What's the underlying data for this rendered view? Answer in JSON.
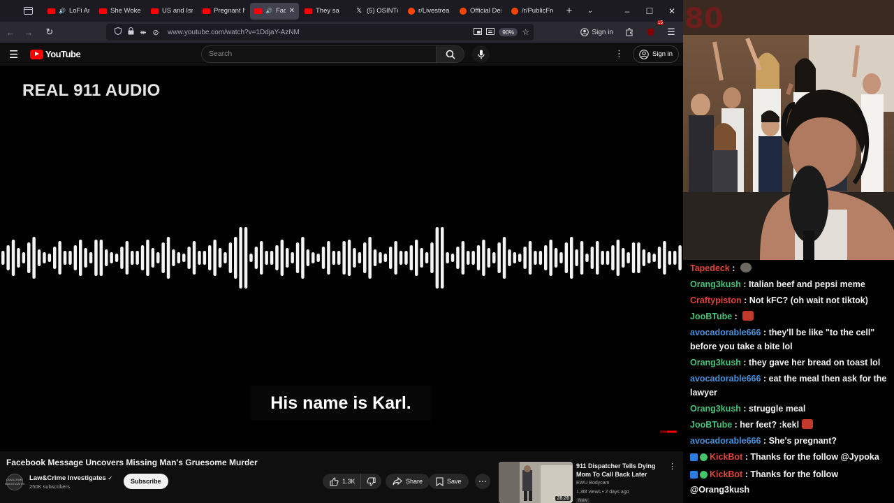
{
  "browser": {
    "tabs": [
      {
        "label": "LoFi Ar",
        "fav": "youtube",
        "audio": true
      },
      {
        "label": "She Woke U",
        "fav": "youtube"
      },
      {
        "label": "US and Isra",
        "fav": "youtube"
      },
      {
        "label": "Pregnant M",
        "fav": "youtube"
      },
      {
        "label": "Face",
        "fav": "youtube",
        "audio": true,
        "active": true
      },
      {
        "label": "They sa",
        "fav": "youtube"
      },
      {
        "label": "(5) OSINTdc",
        "fav": "x"
      },
      {
        "label": "r/Livestrean",
        "fav": "reddit"
      },
      {
        "label": "Official Des",
        "fav": "reddit"
      },
      {
        "label": "/r/PublicFre",
        "fav": "reddit"
      }
    ],
    "url": "www.youtube.com/watch?v=1DdjaY-AzNM",
    "zoom": "90%",
    "signin_label": "Sign in",
    "ext_badge": "15"
  },
  "youtube": {
    "logo_text": "YouTube",
    "search_placeholder": "Search",
    "signin_label": "Sign in"
  },
  "video": {
    "overlay_title": "REAL 911 AUDIO",
    "caption": "His name is Karl.",
    "title": "Facebook Message Uncovers Missing Man's Gruesome Murder",
    "channel": "Law&Crime Investigates",
    "channel_avatar_text": "LAW&CRIME INVESTIGATES",
    "subscribers": "250K subscribers",
    "subscribe_label": "Subscribe",
    "likes": "1.3K",
    "share_label": "Share",
    "save_label": "Save"
  },
  "recommended": {
    "title": "911 Dispatcher Tells Dying Mom To Call Back Later",
    "channel": "EWU Bodycam",
    "meta": "1.3M views • 2 days ago",
    "badge": "New",
    "duration": "28:26"
  },
  "colors": {
    "yt_red": "#ff0000",
    "chat_blue": "#4a90d9",
    "chat_green": "#47c27a",
    "chat_red": "#e0433a"
  },
  "chat": [
    {
      "user": "Tapedeck",
      "color": "#e0433a",
      "text": "",
      "emote": "pepe"
    },
    {
      "user": "Orang3kush",
      "color": "#47c27a",
      "text": "Italian beef and pepsi meme"
    },
    {
      "user": "Craftypiston",
      "color": "#e0433a",
      "text": "Not kFC? (oh wait not tiktok)"
    },
    {
      "user": "JooBTube",
      "color": "#47c27a",
      "text": "",
      "emote": "devil"
    },
    {
      "user": "avocadorable666",
      "color": "#4a90d9",
      "text": "they'll be like \"to the cell\" before you take a bite lol"
    },
    {
      "user": "Orang3kush",
      "color": "#47c27a",
      "text": "they gave her bread on toast lol"
    },
    {
      "user": "avocadorable666",
      "color": "#4a90d9",
      "text": "eat the meal then ask for the lawyer"
    },
    {
      "user": "Orang3kush",
      "color": "#47c27a",
      "text": "struggle meal"
    },
    {
      "user": "JooBTube",
      "color": "#47c27a",
      "text": "her feet? :kekl",
      "emote": "devil"
    },
    {
      "user": "avocadorable666",
      "color": "#4a90d9",
      "text": "She's pregnant?"
    },
    {
      "user": "KickBot",
      "color": "#e0433a",
      "text": "Thanks for the follow @Jypoka",
      "bot": true
    },
    {
      "user": "KickBot",
      "color": "#e0433a",
      "text": "Thanks for the follow @Orang3kush",
      "bot": true
    }
  ]
}
